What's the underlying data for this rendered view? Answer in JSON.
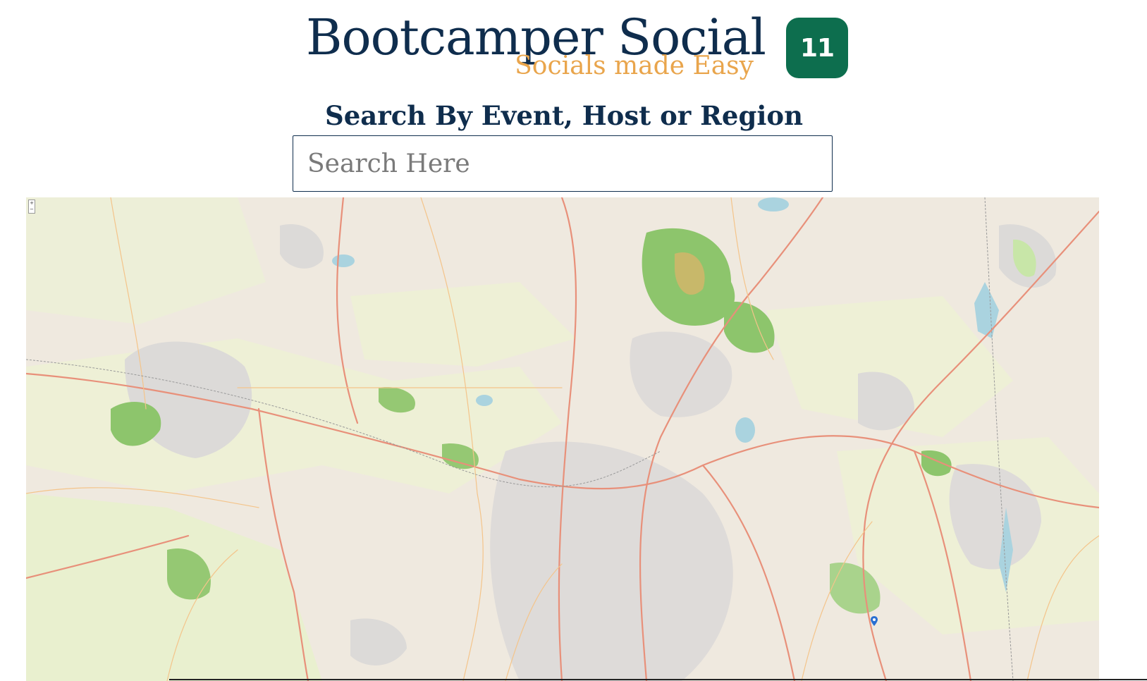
{
  "header": {
    "title": "Bootcamper Social",
    "tagline": "Socials made Easy",
    "badge_count": "11"
  },
  "search": {
    "heading": "Search By Event, Host or Region",
    "placeholder": "Search Here",
    "value": ""
  },
  "map": {
    "zoom_in_label": "+",
    "zoom_out_label": "−",
    "marker_icon": "map-pin-icon",
    "colors": {
      "land": "#efe9df",
      "farmland": "#eef0d6",
      "forest": "#8dc56c",
      "park": "#c8e6a8",
      "urban": "#dcdad8",
      "major_road": "#e8907a",
      "minor_road": "#f4c48a",
      "water": "#aad3df",
      "rail": "#999999"
    }
  },
  "colors": {
    "brand_primary": "#0f2d4d",
    "brand_accent": "#e9a54c",
    "badge_bg": "#0d6e4e"
  }
}
